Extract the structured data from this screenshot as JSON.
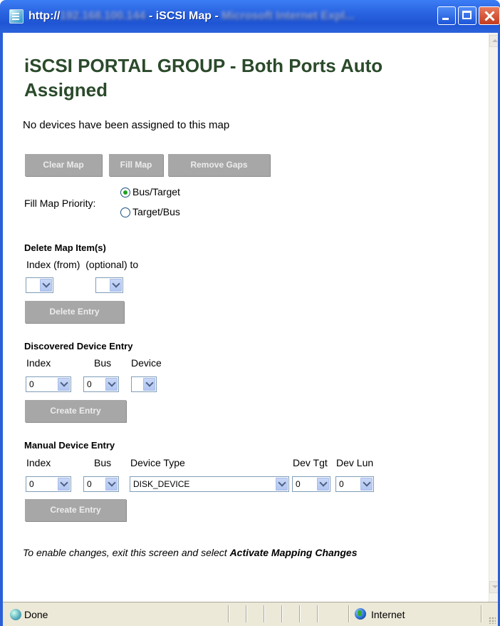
{
  "window": {
    "title_prefix": "http://",
    "title_host_blurred": "192.168.100.144",
    "title_middle": " - iSCSI Map - ",
    "title_app_blurred": "Microsoft Internet Expl..."
  },
  "page": {
    "heading": "iSCSI PORTAL GROUP - Both Ports Auto Assigned",
    "message": "No devices have been assigned to this map"
  },
  "map_buttons": {
    "clear": "Clear Map",
    "fill": "Fill Map",
    "remove_gaps": "Remove Gaps"
  },
  "fill_priority": {
    "label": "Fill Map Priority:",
    "options": [
      "Bus/Target",
      "Target/Bus"
    ],
    "selected": "Bus/Target"
  },
  "delete_section": {
    "title": "Delete Map Item(s)",
    "label": "Index (from)  (optional) to",
    "from_value": "",
    "to_value": "",
    "button": "Delete Entry"
  },
  "discovered_section": {
    "title": "Discovered Device Entry",
    "labels": {
      "index": "Index",
      "bus": "Bus",
      "device": "Device"
    },
    "values": {
      "index": "0",
      "bus": "0",
      "device": ""
    },
    "button": "Create Entry"
  },
  "manual_section": {
    "title": "Manual Device Entry",
    "labels": {
      "index": "Index",
      "bus": "Bus",
      "device_type": "Device Type",
      "dev_tgt": "Dev Tgt",
      "dev_lun": "Dev Lun"
    },
    "values": {
      "index": "0",
      "bus": "0",
      "device_type": "DISK_DEVICE",
      "dev_tgt": "0",
      "dev_lun": "0"
    },
    "button": "Create Entry"
  },
  "footer_note": {
    "prefix": "To enable changes, exit this screen and select ",
    "emphasis": "Activate Mapping Changes"
  },
  "statusbar": {
    "status": "Done",
    "zone": "Internet"
  },
  "colors": {
    "heading": "#2b4a2b",
    "button_bg": "#a7a7a7",
    "titlebar": "#2a63e0"
  }
}
